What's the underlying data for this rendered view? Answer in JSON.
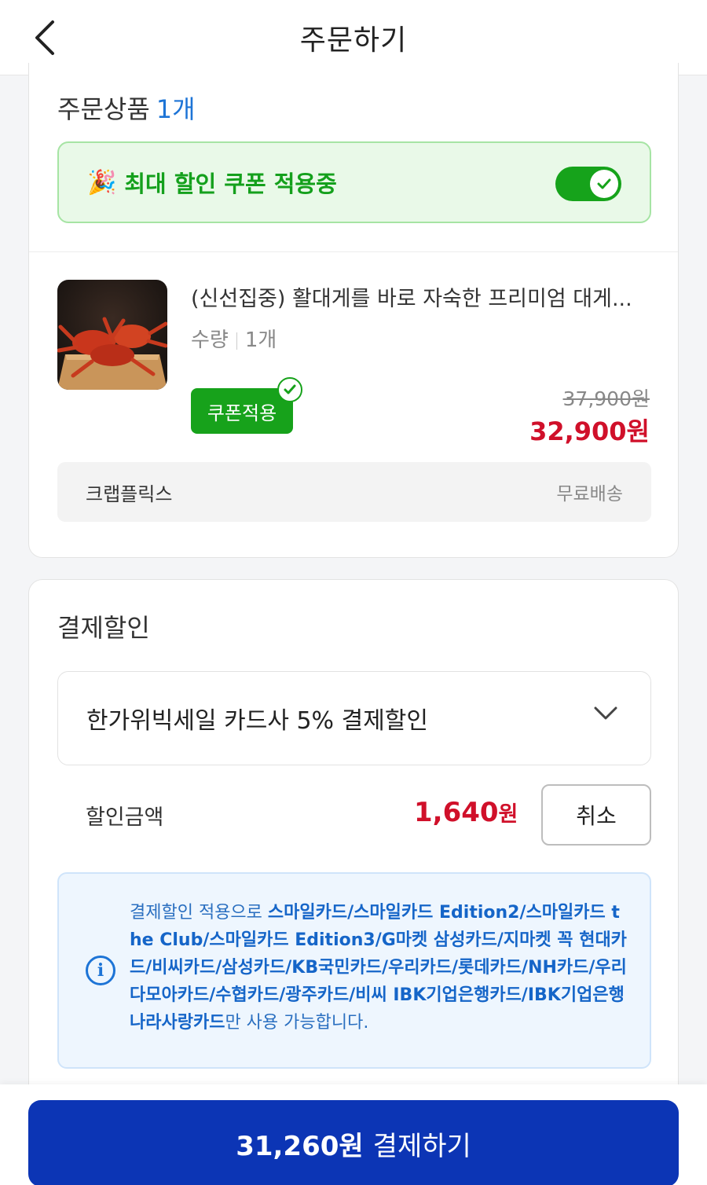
{
  "header": {
    "title": "주문하기",
    "back_icon": "chevron-left-icon"
  },
  "order": {
    "title": "주문상품",
    "count": "1개",
    "coupon_banner": {
      "emoji": "🎉",
      "text": "최대 할인 쿠폰 적용중",
      "toggle_on": true
    },
    "product": {
      "name": "(신선집중) 활대게를 바로 자숙한 프리미엄 대게...",
      "qty_label": "수량",
      "qty_value": "1개",
      "coupon_badge": "쿠폰적용",
      "original_price": "37,900원",
      "sale_price": "32,900원"
    },
    "seller": {
      "name": "크랩플릭스",
      "shipping": "무료배송"
    }
  },
  "payment_discount": {
    "title": "결제할인",
    "selected_option": "한가위빅세일 카드사 5% 결제할인",
    "discount_label": "할인금액",
    "discount_amount": "1,640",
    "discount_unit": "원",
    "cancel_label": "취소",
    "info": {
      "prefix": "결제할인 적용으로 ",
      "cards": "스마일카드/스마일카드 Edition2/스마일카드 the Club/스마일카드 Edition3/G마켓 삼성카드/지마켓 꼭 현대카드/비씨카드/삼성카드/KB국민카드/우리카드/롯데카드/NH카드/우리다모아카드/수협카드/광주카드/비씨 IBK기업은행카드/IBK기업은행 나라사랑카드",
      "suffix": "만 사용 가능합니다."
    }
  },
  "footer": {
    "amount": "31,260원",
    "label": "결제하기"
  },
  "colors": {
    "accent_blue": "#0c35b5",
    "green": "#16a31b",
    "price_red": "#d0102a",
    "link_blue": "#1d74d6"
  }
}
